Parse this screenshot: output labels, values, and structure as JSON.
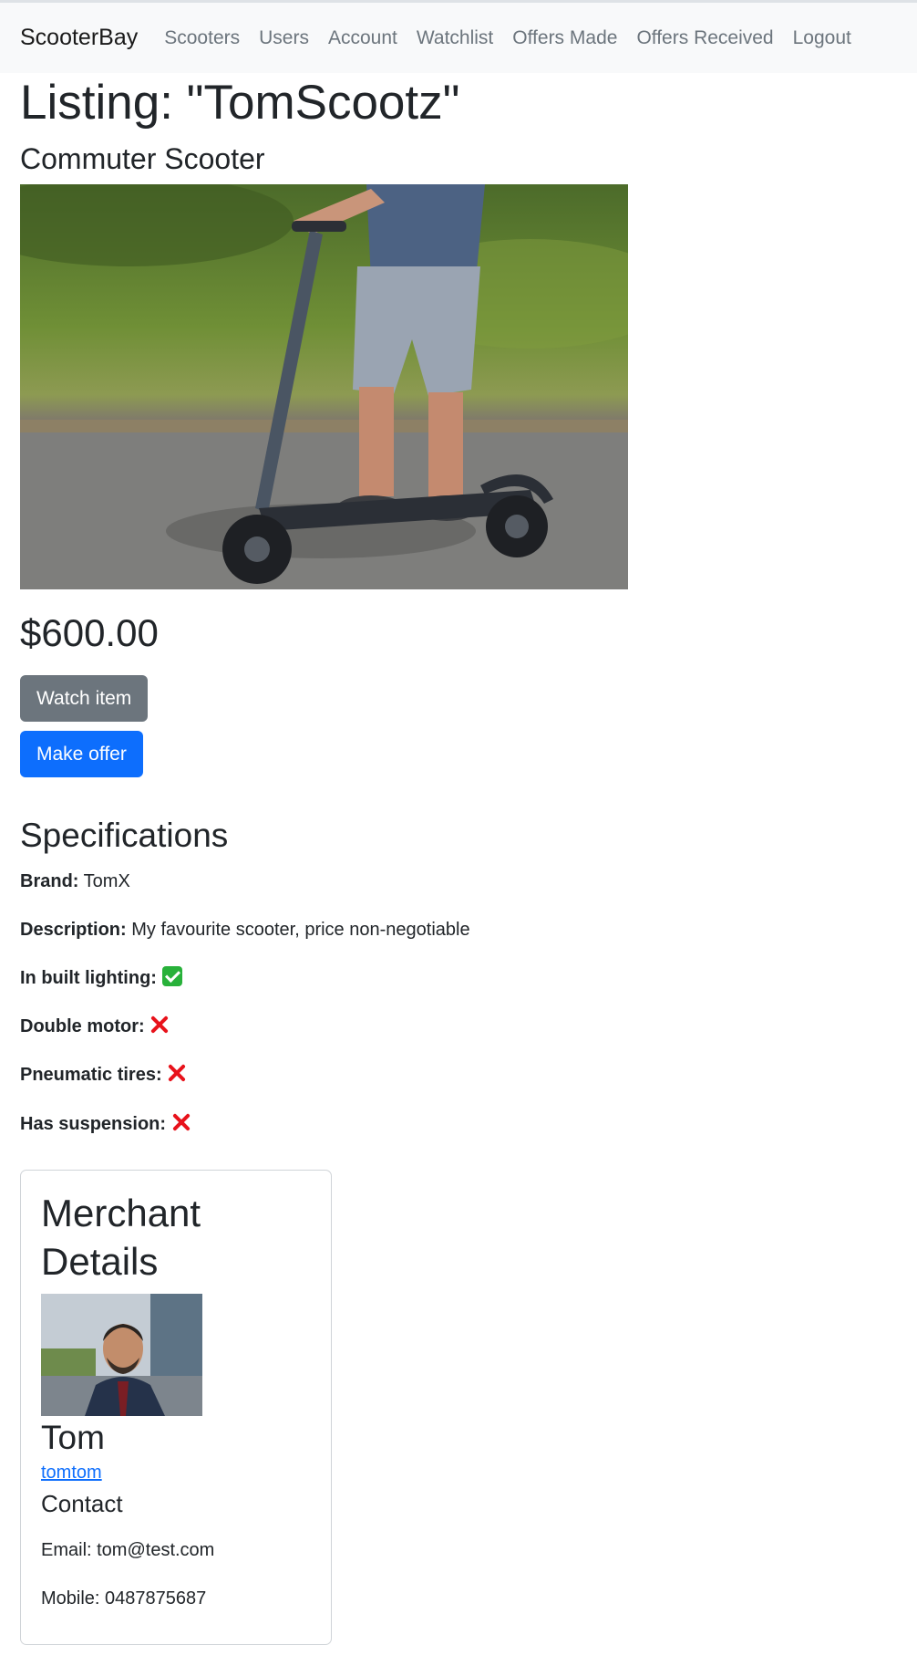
{
  "nav": {
    "brand": "ScooterBay",
    "links": [
      "Scooters",
      "Users",
      "Account",
      "Watchlist",
      "Offers Made",
      "Offers Received",
      "Logout"
    ]
  },
  "listing": {
    "title": "Listing: \"TomScootz\"",
    "subtitle": "Commuter Scooter",
    "price": "$600.00",
    "watch_label": "Watch item",
    "offer_label": "Make offer"
  },
  "specs": {
    "heading": "Specifications",
    "brand_label": "Brand:",
    "brand_value": "TomX",
    "description_label": "Description:",
    "description_value": "My favourite scooter, price non-negotiable",
    "lighting_label": "In built lighting:",
    "lighting_value": true,
    "double_motor_label": "Double motor:",
    "double_motor_value": false,
    "pneumatic_label": "Pneumatic tires:",
    "pneumatic_value": false,
    "suspension_label": "Has suspension:",
    "suspension_value": false
  },
  "merchant": {
    "heading_line1": "Merchant",
    "heading_line2": "Details",
    "name": "Tom",
    "username": "tomtom",
    "contact_heading": "Contact",
    "email": "Email: tom@test.com",
    "mobile": "Mobile: 0487875687"
  },
  "colors": {
    "watch_button": "#6c757d",
    "offer_button": "#0d6efd",
    "check": "#28b13a",
    "cross": "#e8121b"
  },
  "icons": {
    "true": "check-icon",
    "false": "cross-icon"
  }
}
